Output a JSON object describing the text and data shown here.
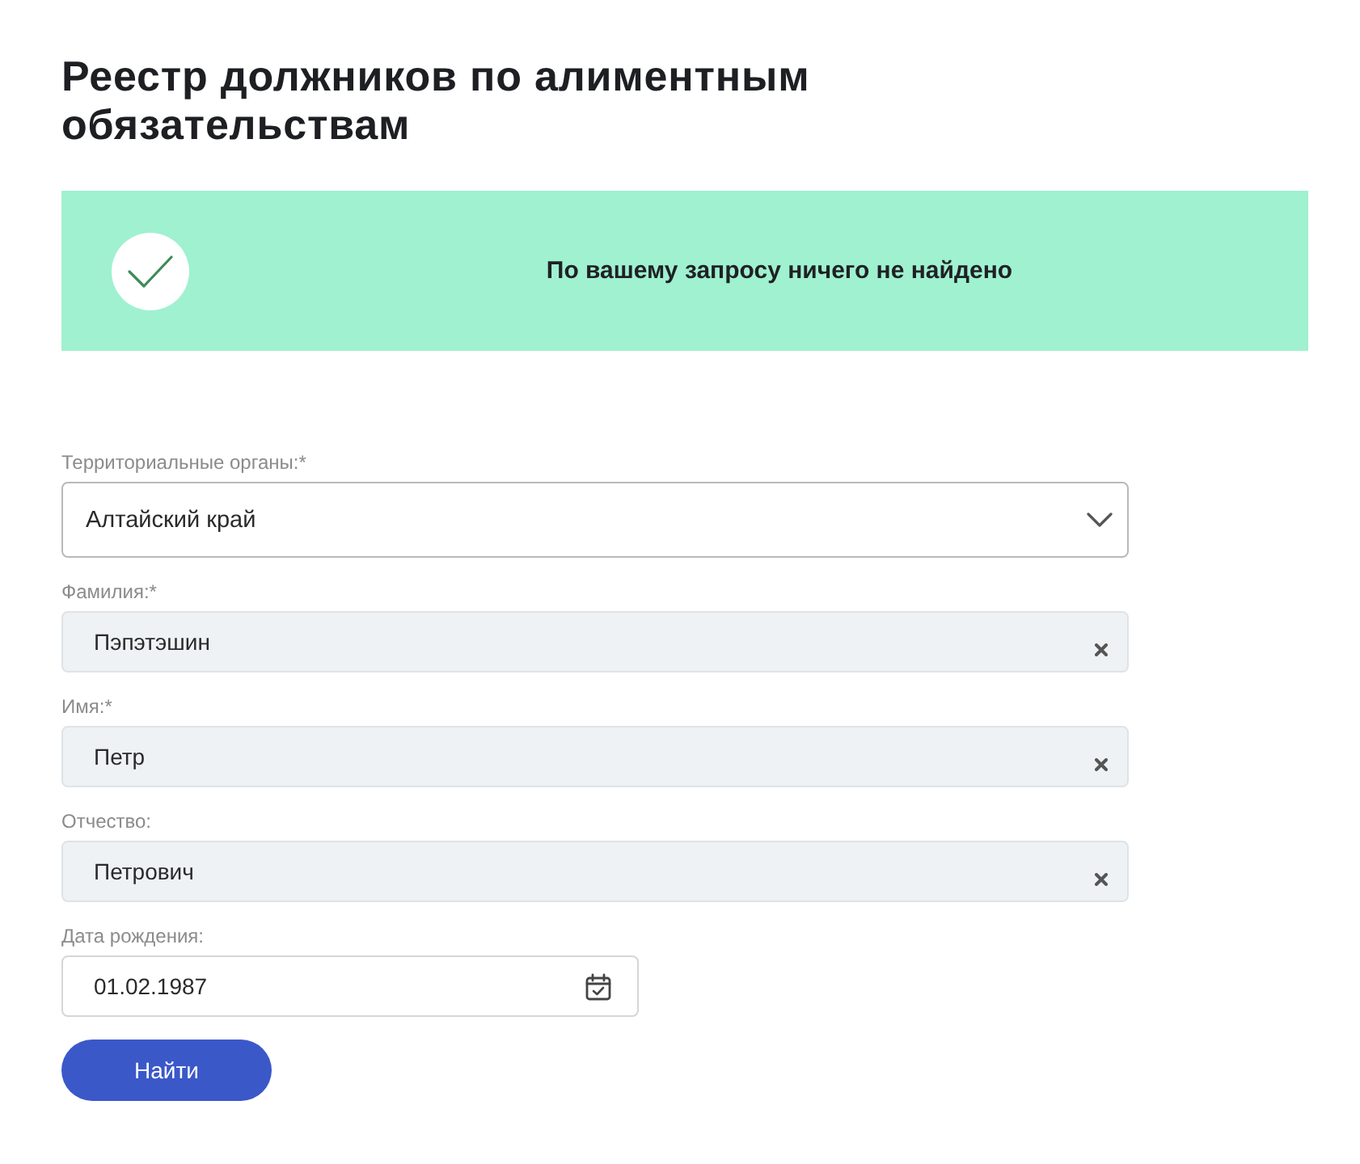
{
  "page": {
    "title": "Реестр должников по алиментным обязательствам"
  },
  "notice": {
    "message": "По вашему запросу ничего не найдено"
  },
  "form": {
    "fields": [
      {
        "kind": "select",
        "label": "Территориальные органы:*",
        "value": "Алтайский край"
      },
      {
        "kind": "text",
        "label": "Фамилия:*",
        "value": "Пэпэтэшин"
      },
      {
        "kind": "text",
        "label": "Имя:*",
        "value": "Петр"
      },
      {
        "kind": "text",
        "label": "Отчество:",
        "value": "Петрович"
      },
      {
        "kind": "date",
        "label": "Дата рождения:",
        "value": "01.02.1987"
      }
    ],
    "submit": {
      "label": "Найти"
    }
  }
}
